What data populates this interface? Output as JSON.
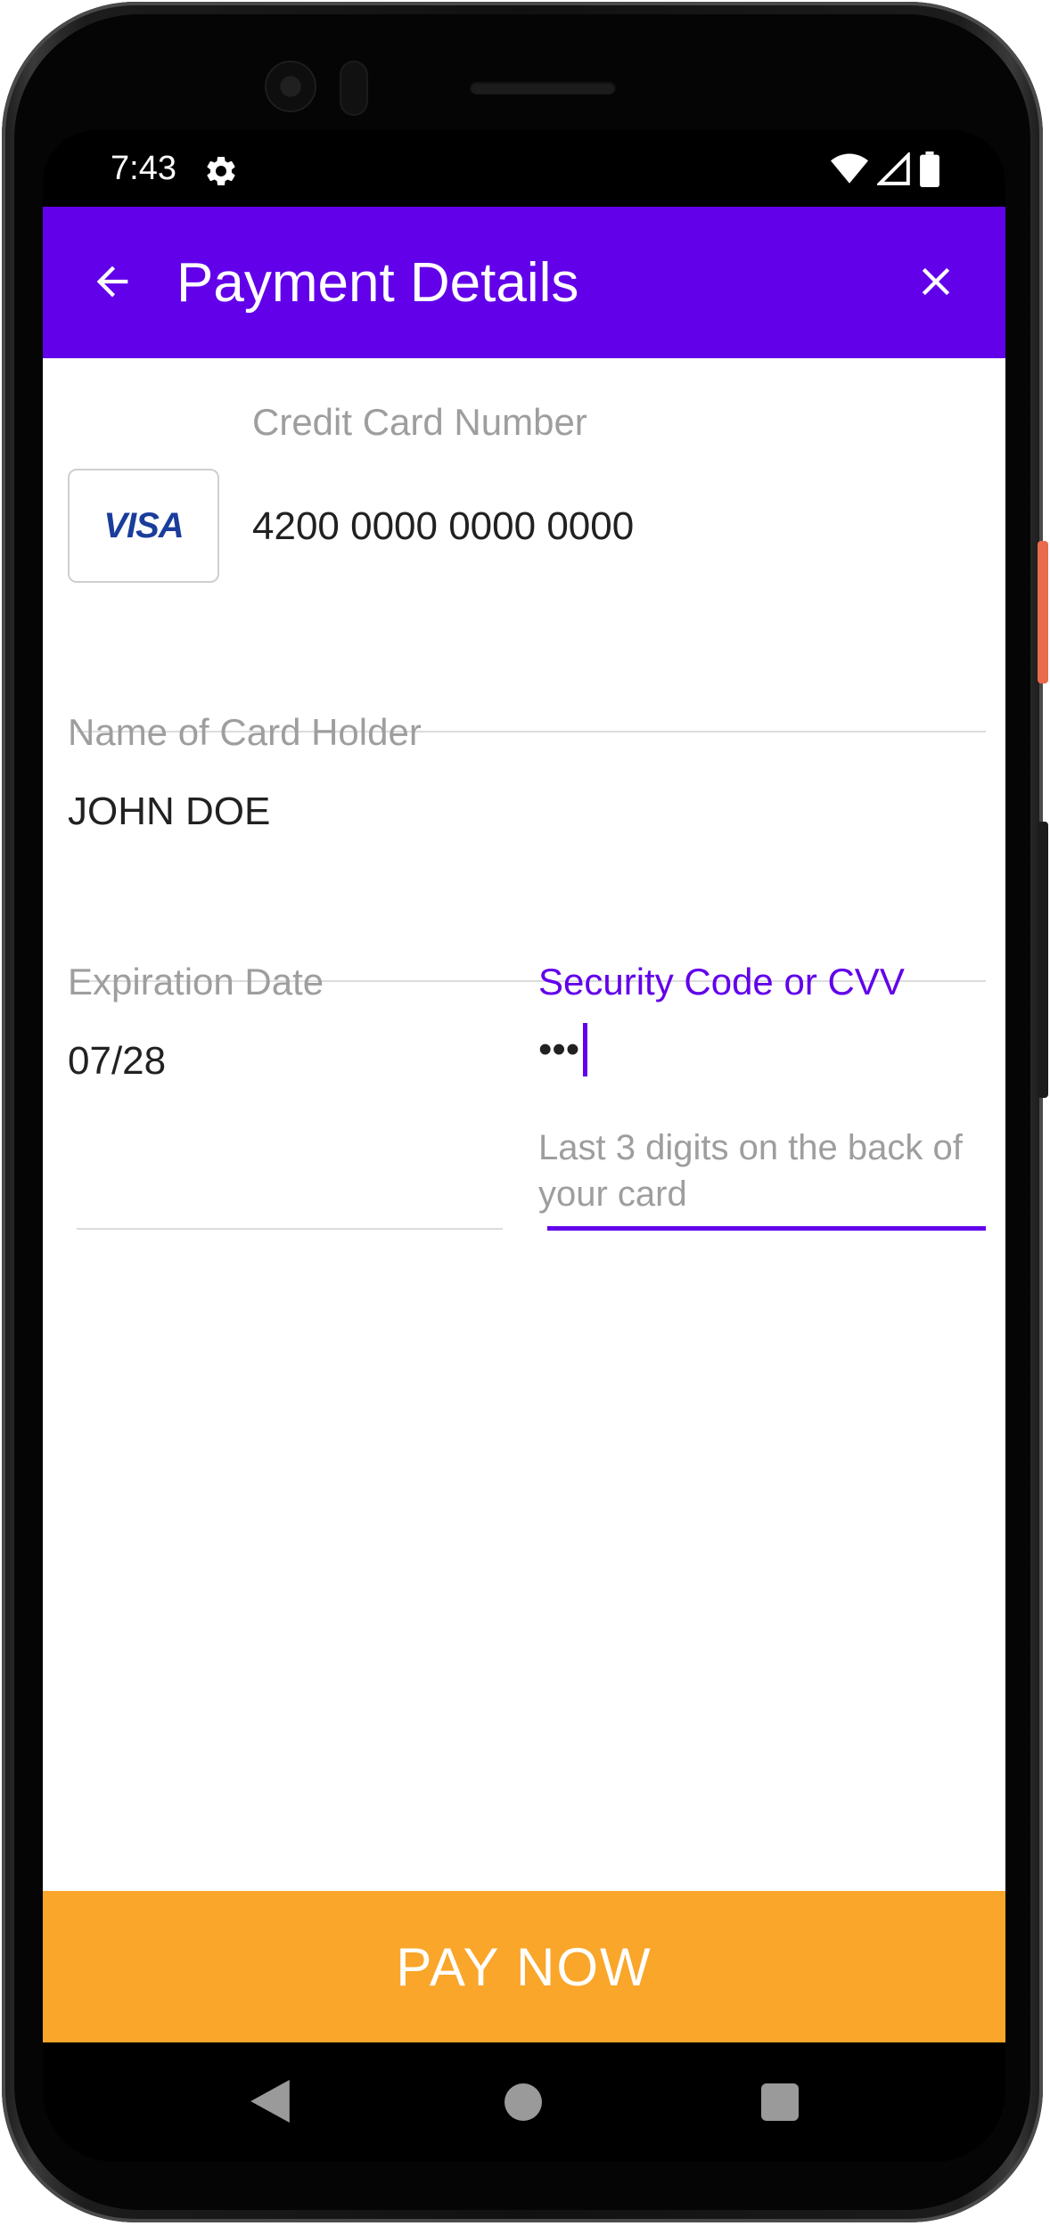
{
  "status_bar": {
    "time": "7:43",
    "icons": [
      "gear-icon",
      "wifi-icon",
      "signal-icon",
      "battery-icon"
    ]
  },
  "app_bar": {
    "title": "Payment Details",
    "back_icon": "arrow-left-icon",
    "close_icon": "close-icon",
    "background": "#6200ea"
  },
  "form": {
    "card_number": {
      "label": "Credit Card Number",
      "value": "4200 0000 0000 0000",
      "brand": "VISA"
    },
    "card_holder": {
      "label": "Name of Card Holder",
      "value": "JOHN DOE"
    },
    "expiration": {
      "label": "Expiration Date",
      "value": "07/28"
    },
    "cvv": {
      "label": "Security Code or CVV",
      "value": "•••",
      "helper": "Last 3 digits on the back of your card",
      "focused": true
    }
  },
  "pay_button": {
    "label": "PAY NOW",
    "background": "#f9a62a"
  },
  "nav_bar": {
    "icons": [
      "nav-back-icon",
      "nav-home-icon",
      "nav-recents-icon"
    ]
  }
}
